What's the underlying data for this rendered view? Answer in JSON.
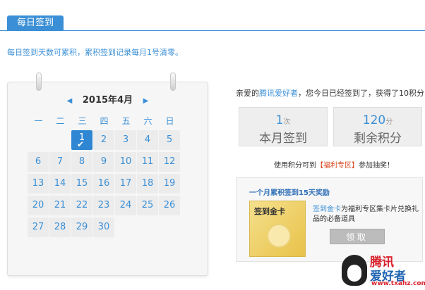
{
  "header": {
    "tab_label": "每日签到"
  },
  "notice": "每日签到天数可累积，累积签到记录每月1号清零。",
  "calendar": {
    "month_label": "2015年4月",
    "prev_icon": "triangle-left-icon",
    "next_icon": "triangle-right-icon",
    "weekdays": [
      "一",
      "二",
      "三",
      "四",
      "五",
      "六",
      "日"
    ],
    "days": [
      {
        "n": "1",
        "signed": true
      },
      {
        "n": "2"
      },
      {
        "n": "3"
      },
      {
        "n": "4"
      },
      {
        "n": "5"
      },
      {
        "n": "6"
      },
      {
        "n": "7"
      },
      {
        "n": "8"
      },
      {
        "n": "9"
      },
      {
        "n": "10"
      },
      {
        "n": "11"
      },
      {
        "n": "12"
      },
      {
        "n": "13"
      },
      {
        "n": "14"
      },
      {
        "n": "15"
      },
      {
        "n": "16"
      },
      {
        "n": "17"
      },
      {
        "n": "18"
      },
      {
        "n": "19"
      },
      {
        "n": "20"
      },
      {
        "n": "21"
      },
      {
        "n": "22"
      },
      {
        "n": "23"
      },
      {
        "n": "24"
      },
      {
        "n": "25"
      },
      {
        "n": "26"
      },
      {
        "n": "27"
      },
      {
        "n": "28"
      },
      {
        "n": "29"
      },
      {
        "n": "30"
      }
    ],
    "first_weekday_index": 2
  },
  "greeting": {
    "prefix": "亲爱的",
    "name": "腾讯爱好者",
    "suffix": "，您今日已经签到了，获得了10积分!"
  },
  "stats": {
    "month_sign": {
      "value": "1",
      "unit": "次",
      "label": "本月签到"
    },
    "points": {
      "value": "120",
      "unit": "分",
      "label": "剩余积分"
    }
  },
  "redeem": {
    "prefix": "使用积分可到",
    "link": "【福利专区】",
    "suffix": "参加抽奖！"
  },
  "reward": {
    "title": "一个月累积签到15天奖励",
    "card_label": "签到金卡",
    "desc_link": "签到金卡",
    "desc_text": "为福利专区集卡片兑换礼品的必备道具",
    "claim_label": "领取"
  },
  "watermark": {
    "title": "腾讯",
    "subtitle": "爱好者",
    "url": "www.txahz.com"
  },
  "colors": {
    "accent": "#3a8fd6",
    "red": "#d9431c",
    "gold": "#e8c24a"
  }
}
